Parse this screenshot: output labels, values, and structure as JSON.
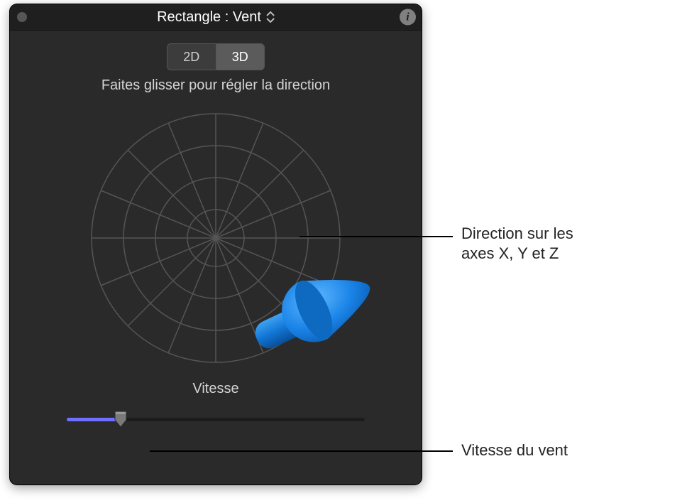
{
  "header": {
    "title": "Rectangle : Vent"
  },
  "mode_toggle": {
    "options": [
      "2D",
      "3D"
    ],
    "selected": "3D"
  },
  "instruction_text": "Faites glisser pour régler la direction",
  "dial": {
    "arrow_color": "#1e90ff",
    "angle_deg": 30
  },
  "speed": {
    "label": "Vitesse",
    "value_percent": 18
  },
  "callouts": {
    "direction": "Direction sur les\naxes X, Y et Z",
    "speed": "Vitesse du vent"
  }
}
